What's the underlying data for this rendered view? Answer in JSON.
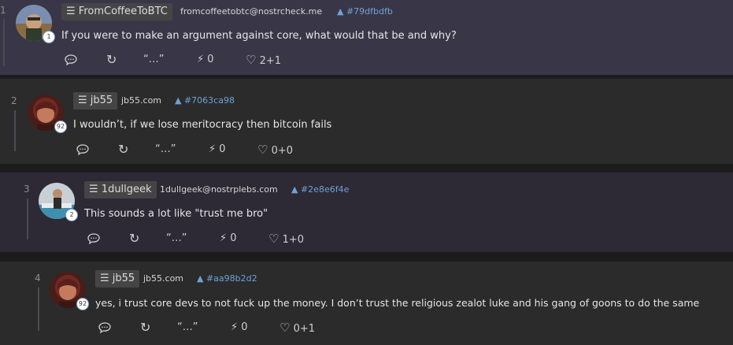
{
  "notes": [
    {
      "index": "1",
      "name": "FromCoffeeToBTC",
      "nip05": "fromcoffeetobtc@nostrcheck.me",
      "id": "#79dfbdfb",
      "count": "1",
      "content": "If you were to make an argument against core, what would that be and why?",
      "quote": "“…”",
      "zaps": "0",
      "likes": "2+1"
    },
    {
      "index": "2",
      "name": "jb55",
      "nip05": "jb55.com",
      "id": "#7063ca98",
      "count": "92",
      "content": "I wouldn’t, if we lose meritocracy then bitcoin fails",
      "quote": "“…”",
      "zaps": "0",
      "likes": "0+0"
    },
    {
      "index": "3",
      "name": "1dullgeek",
      "nip05": "1dullgeek@nostrplebs.com",
      "id": "#2e8e6f4e",
      "count": "2",
      "content": "This sounds a lot like \"trust me bro\"",
      "quote": "“…”",
      "zaps": "0",
      "likes": "1+0"
    },
    {
      "index": "4",
      "name": "jb55",
      "nip05": "jb55.com",
      "id": "#aa98b2d2",
      "count": "92",
      "content": "yes, i trust core devs to not fuck up the money. I don’t trust the religious zealot luke and his gang of goons to do the same",
      "quote": "“…”",
      "zaps": "0",
      "likes": "0+1"
    }
  ],
  "icons": {
    "menu": "menu-icon",
    "id": "triangle-icon",
    "reply": "speech-bubble-icon",
    "repost": "repost-icon",
    "zap": "lightning-icon",
    "like": "heart-icon"
  }
}
